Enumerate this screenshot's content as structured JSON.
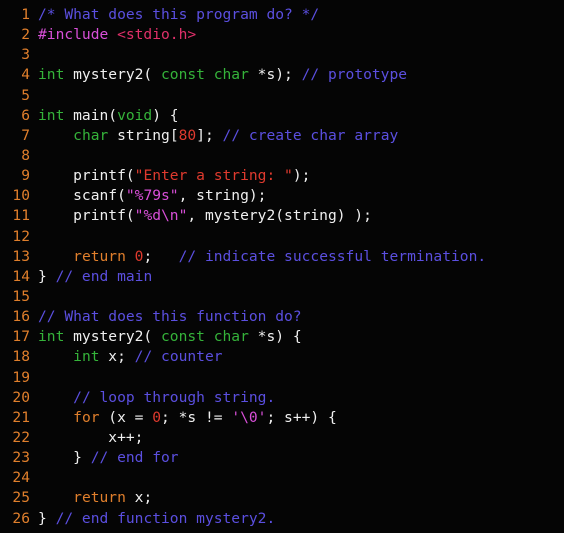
{
  "editor": {
    "background": "#050505",
    "colors": {
      "line_number": "#e07f2c",
      "type_keyword": "#35b33a",
      "control_keyword": "#e07f2c",
      "comment": "#5b4fe0",
      "preprocessor": "#d84fd8",
      "string": "#e03a2e",
      "format_specifier": "#d84fd8",
      "number": "#e03a2e",
      "plain": "#f0f0f0"
    },
    "lines": [
      {
        "n": "1",
        "tokens": [
          [
            "cm",
            "/* What does this program do? */"
          ]
        ]
      },
      {
        "n": "2",
        "tokens": [
          [
            "pp",
            "#include "
          ],
          [
            "inc",
            "<stdio.h>"
          ]
        ]
      },
      {
        "n": "3",
        "tokens": []
      },
      {
        "n": "4",
        "tokens": [
          [
            "kw-type",
            "int"
          ],
          [
            "plain",
            " mystery2( "
          ],
          [
            "kw-type",
            "const char"
          ],
          [
            "plain",
            " *s); "
          ],
          [
            "cm",
            "// prototype"
          ]
        ]
      },
      {
        "n": "5",
        "tokens": []
      },
      {
        "n": "6",
        "tokens": [
          [
            "kw-type",
            "int"
          ],
          [
            "plain",
            " main("
          ],
          [
            "kw-type",
            "void"
          ],
          [
            "plain",
            ") {"
          ]
        ]
      },
      {
        "n": "7",
        "tokens": [
          [
            "plain",
            "    "
          ],
          [
            "kw-type",
            "char"
          ],
          [
            "plain",
            " string["
          ],
          [
            "num",
            "80"
          ],
          [
            "plain",
            "]; "
          ],
          [
            "cm",
            "// create char array"
          ]
        ]
      },
      {
        "n": "8",
        "tokens": []
      },
      {
        "n": "9",
        "tokens": [
          [
            "plain",
            "    printf("
          ],
          [
            "str",
            "\"Enter a string: \""
          ],
          [
            "plain",
            ");"
          ]
        ]
      },
      {
        "n": "10",
        "tokens": [
          [
            "plain",
            "    scanf("
          ],
          [
            "fmt",
            "\"%79s\""
          ],
          [
            "plain",
            ", string);"
          ]
        ]
      },
      {
        "n": "11",
        "tokens": [
          [
            "plain",
            "    printf("
          ],
          [
            "fmt",
            "\"%d\\n\""
          ],
          [
            "plain",
            ", mystery2(string) );"
          ]
        ]
      },
      {
        "n": "12",
        "tokens": []
      },
      {
        "n": "13",
        "tokens": [
          [
            "plain",
            "    "
          ],
          [
            "kw-ctrl",
            "return"
          ],
          [
            "plain",
            " "
          ],
          [
            "num",
            "0"
          ],
          [
            "plain",
            ";   "
          ],
          [
            "cm",
            "// indicate successful termination."
          ]
        ]
      },
      {
        "n": "14",
        "tokens": [
          [
            "plain",
            "} "
          ],
          [
            "cm",
            "// end main"
          ]
        ]
      },
      {
        "n": "15",
        "tokens": []
      },
      {
        "n": "16",
        "tokens": [
          [
            "cm",
            "// What does this function do?"
          ]
        ]
      },
      {
        "n": "17",
        "tokens": [
          [
            "kw-type",
            "int"
          ],
          [
            "plain",
            " mystery2( "
          ],
          [
            "kw-type",
            "const char"
          ],
          [
            "plain",
            " *s) {"
          ]
        ]
      },
      {
        "n": "18",
        "tokens": [
          [
            "plain",
            "    "
          ],
          [
            "kw-type",
            "int"
          ],
          [
            "plain",
            " x; "
          ],
          [
            "cm",
            "// counter"
          ]
        ]
      },
      {
        "n": "19",
        "tokens": []
      },
      {
        "n": "20",
        "tokens": [
          [
            "plain",
            "    "
          ],
          [
            "cm",
            "// loop through string."
          ]
        ]
      },
      {
        "n": "21",
        "tokens": [
          [
            "plain",
            "    "
          ],
          [
            "kw-ctrl",
            "for"
          ],
          [
            "plain",
            " (x = "
          ],
          [
            "num",
            "0"
          ],
          [
            "plain",
            "; *s != "
          ],
          [
            "fmt",
            "'\\0'"
          ],
          [
            "plain",
            "; s++) {"
          ]
        ]
      },
      {
        "n": "22",
        "tokens": [
          [
            "plain",
            "        x++;"
          ]
        ]
      },
      {
        "n": "23",
        "tokens": [
          [
            "plain",
            "    } "
          ],
          [
            "cm",
            "// end for"
          ]
        ]
      },
      {
        "n": "24",
        "tokens": []
      },
      {
        "n": "25",
        "tokens": [
          [
            "plain",
            "    "
          ],
          [
            "kw-ctrl",
            "return"
          ],
          [
            "plain",
            " x;"
          ]
        ]
      },
      {
        "n": "26",
        "tokens": [
          [
            "plain",
            "} "
          ],
          [
            "cm",
            "// end function mystery2."
          ]
        ]
      }
    ]
  }
}
